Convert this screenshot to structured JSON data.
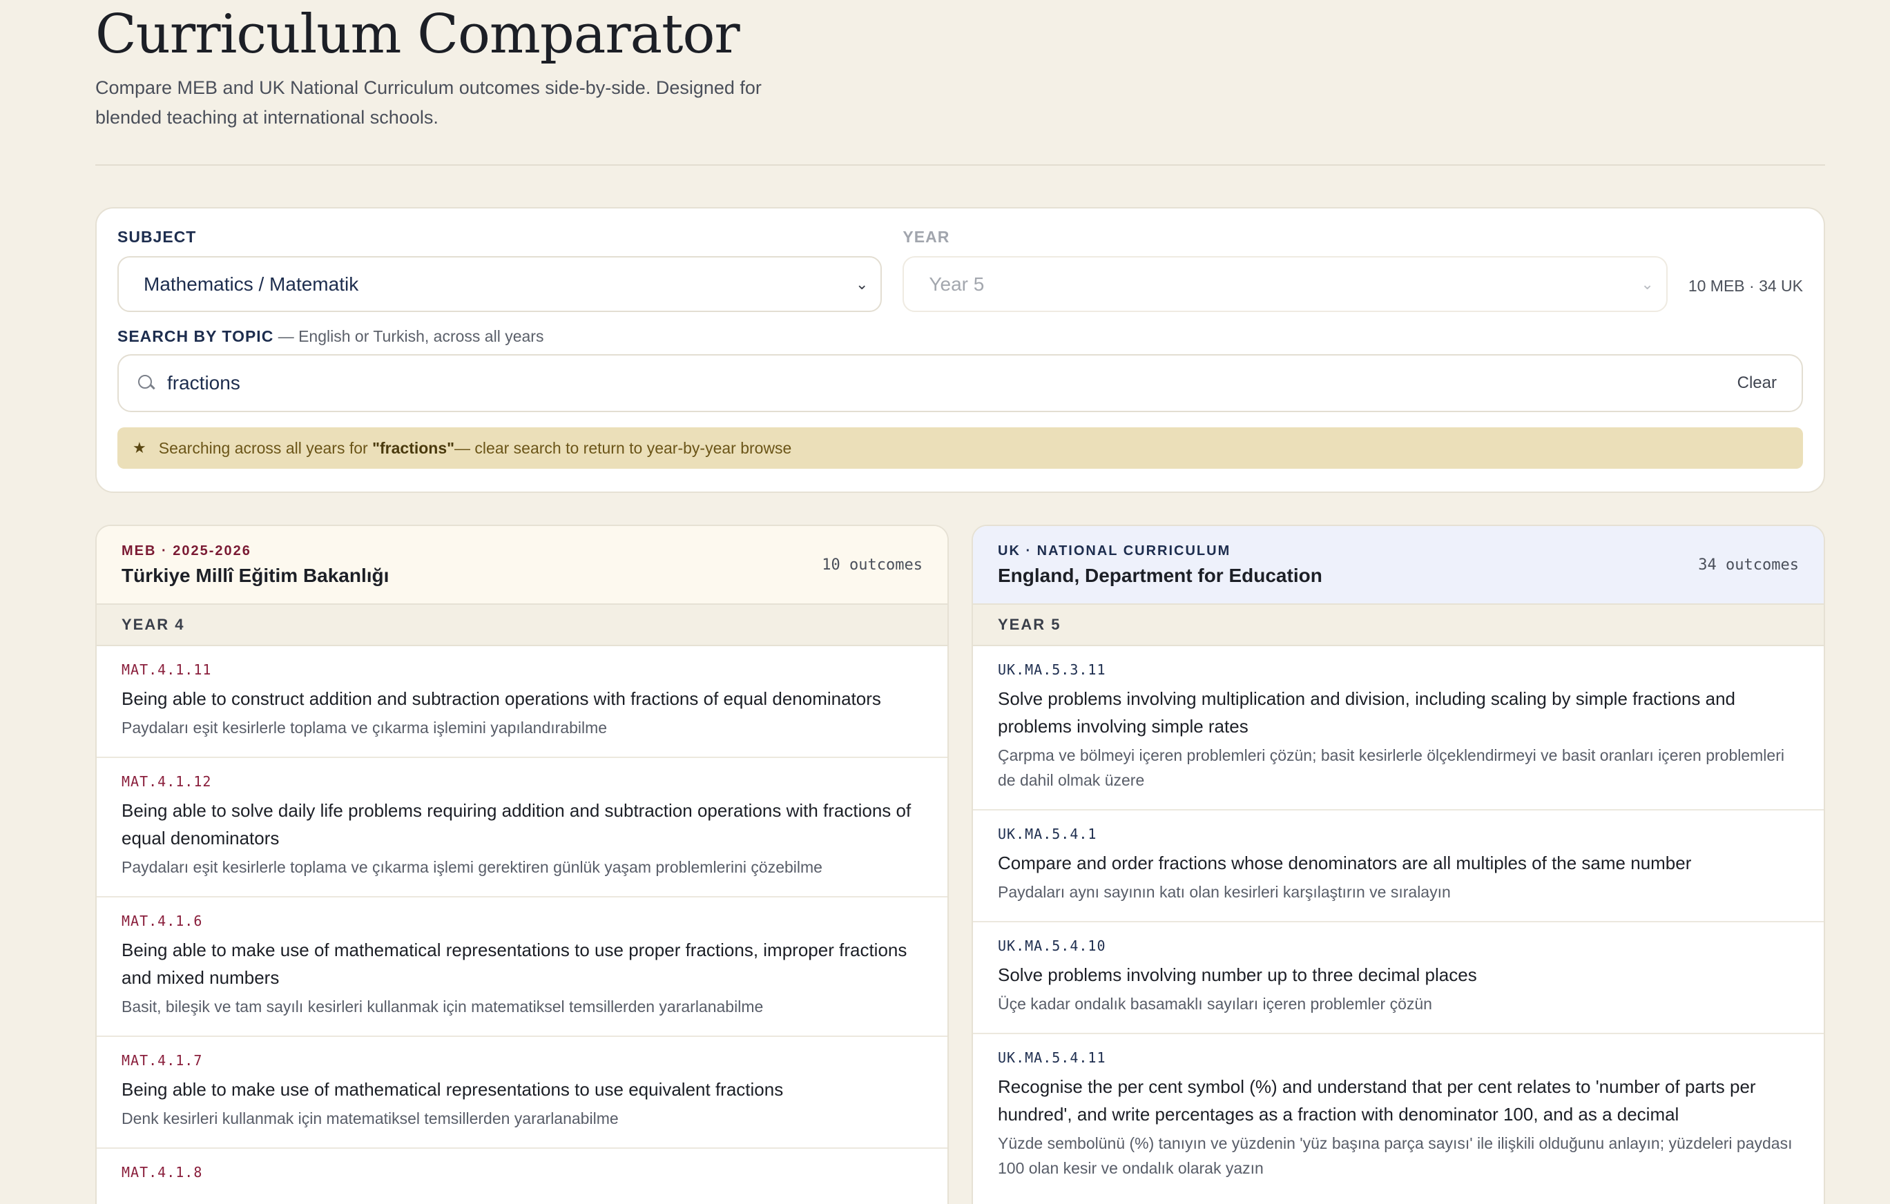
{
  "header": {
    "title": "Curriculum Comparator",
    "subtitle": "Compare MEB and UK National Curriculum outcomes side-by-side. Designed for blended teaching at international schools."
  },
  "controls": {
    "subject_label": "SUBJECT",
    "subject_value": "Mathematics / Matematik",
    "year_label": "YEAR",
    "year_value": "Year 5",
    "counts": "10 MEB · 34 UK",
    "search_label": "SEARCH BY TOPIC",
    "search_hint": " — English or Turkish, across all years",
    "search_value": "fractions",
    "clear_label": "Clear",
    "banner_prefix": "Searching across all years for ",
    "banner_term": "\"fractions\"",
    "banner_suffix": " — clear search to return to year-by-year browse"
  },
  "meb": {
    "kicker": "MEB · 2025-2026",
    "title": "Türkiye Millî Eğitim Bakanlığı",
    "count": "10 outcomes",
    "year": "YEAR 4",
    "outcomes": [
      {
        "code": "MAT.4.1.11",
        "en": "Being able to construct addition and subtraction operations with fractions of equal denominators",
        "tr": "Paydaları eşit kesirlerle toplama ve çıkarma işlemini yapılandırabilme"
      },
      {
        "code": "MAT.4.1.12",
        "en": "Being able to solve daily life problems requiring addition and subtraction operations with fractions of equal denominators",
        "tr": "Paydaları eşit kesirlerle toplama ve çıkarma işlemi gerektiren günlük yaşam problemlerini çözebilme"
      },
      {
        "code": "MAT.4.1.6",
        "en": "Being able to make use of mathematical representations to use proper fractions, improper fractions and mixed numbers",
        "tr": "Basit, bileşik ve tam sayılı kesirleri kullanmak için matematiksel temsillerden yararlanabilme"
      },
      {
        "code": "MAT.4.1.7",
        "en": "Being able to make use of mathematical representations to use equivalent fractions",
        "tr": "Denk kesirleri kullanmak için matematiksel temsillerden yararlanabilme"
      },
      {
        "code": "MAT.4.1.8",
        "en": "",
        "tr": ""
      }
    ]
  },
  "uk": {
    "kicker": "UK · NATIONAL CURRICULUM",
    "title": "England, Department for Education",
    "count": "34 outcomes",
    "year": "YEAR 5",
    "outcomes": [
      {
        "code": "UK.MA.5.3.11",
        "en": "Solve problems involving multiplication and division, including scaling by simple fractions and problems involving simple rates",
        "tr": "Çarpma ve bölmeyi içeren problemleri çözün; basit kesirlerle ölçeklendirmeyi ve basit oranları içeren problemleri de dahil olmak üzere"
      },
      {
        "code": "UK.MA.5.4.1",
        "en": "Compare and order fractions whose denominators are all multiples of the same number",
        "tr": "Paydaları aynı sayının katı olan kesirleri karşılaştırın ve sıralayın"
      },
      {
        "code": "UK.MA.5.4.10",
        "en": "Solve problems involving number up to three decimal places",
        "tr": "Üçe kadar ondalık basamaklı sayıları içeren problemler çözün"
      },
      {
        "code": "UK.MA.5.4.11",
        "en": "Recognise the per cent symbol (%) and understand that per cent relates to 'number of parts per hundred', and write percentages as a fraction with denominator 100, and as a decimal",
        "tr": "Yüzde sembolünü (%) tanıyın ve yüzdenin 'yüz başına parça sayısı' ile ilişkili olduğunu anlayın; yüzdeleri paydası 100 olan kesir ve ondalık olarak yazın"
      }
    ]
  }
}
